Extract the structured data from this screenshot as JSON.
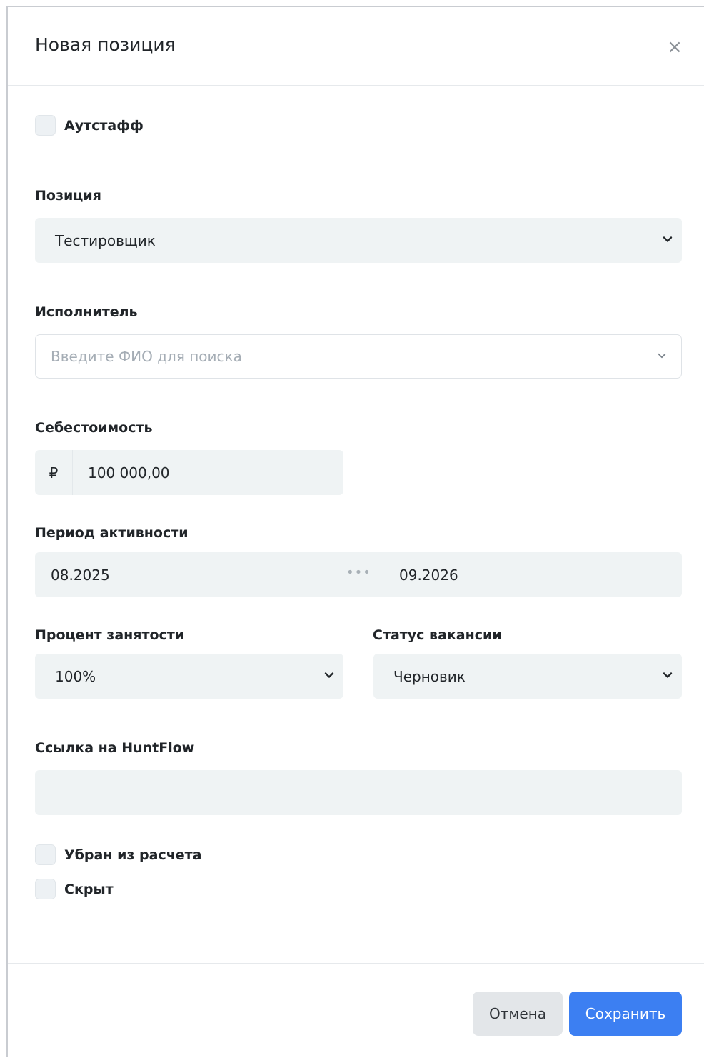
{
  "modal": {
    "title": "Новая позиция",
    "close_icon": "close-icon"
  },
  "outstaff": {
    "label": "Аутстафф",
    "checked": false
  },
  "position": {
    "label": "Позиция",
    "value": "Тестировщик"
  },
  "executor": {
    "label": "Исполнитель",
    "placeholder": "Введите ФИО для поиска"
  },
  "cost": {
    "label": "Себестоимость",
    "currency": "₽",
    "value": "100 000,00"
  },
  "period": {
    "label": "Период активности",
    "from": "08.2025",
    "separator": "•••",
    "to": "09.2026"
  },
  "employment": {
    "label": "Процент занятости",
    "value": "100%"
  },
  "vacancy_status": {
    "label": "Статус вакансии",
    "value": "Черновик"
  },
  "huntflow": {
    "label": "Ссылка на HuntFlow",
    "value": ""
  },
  "excluded": {
    "label": "Убран из расчета",
    "checked": false
  },
  "hidden": {
    "label": "Скрыт",
    "checked": false
  },
  "footer": {
    "cancel_label": "Отмена",
    "save_label": "Сохранить"
  },
  "colors": {
    "primary": "#3c7ff2",
    "field_bg": "#eff3f4",
    "cancel_bg": "#e3e6e9"
  }
}
